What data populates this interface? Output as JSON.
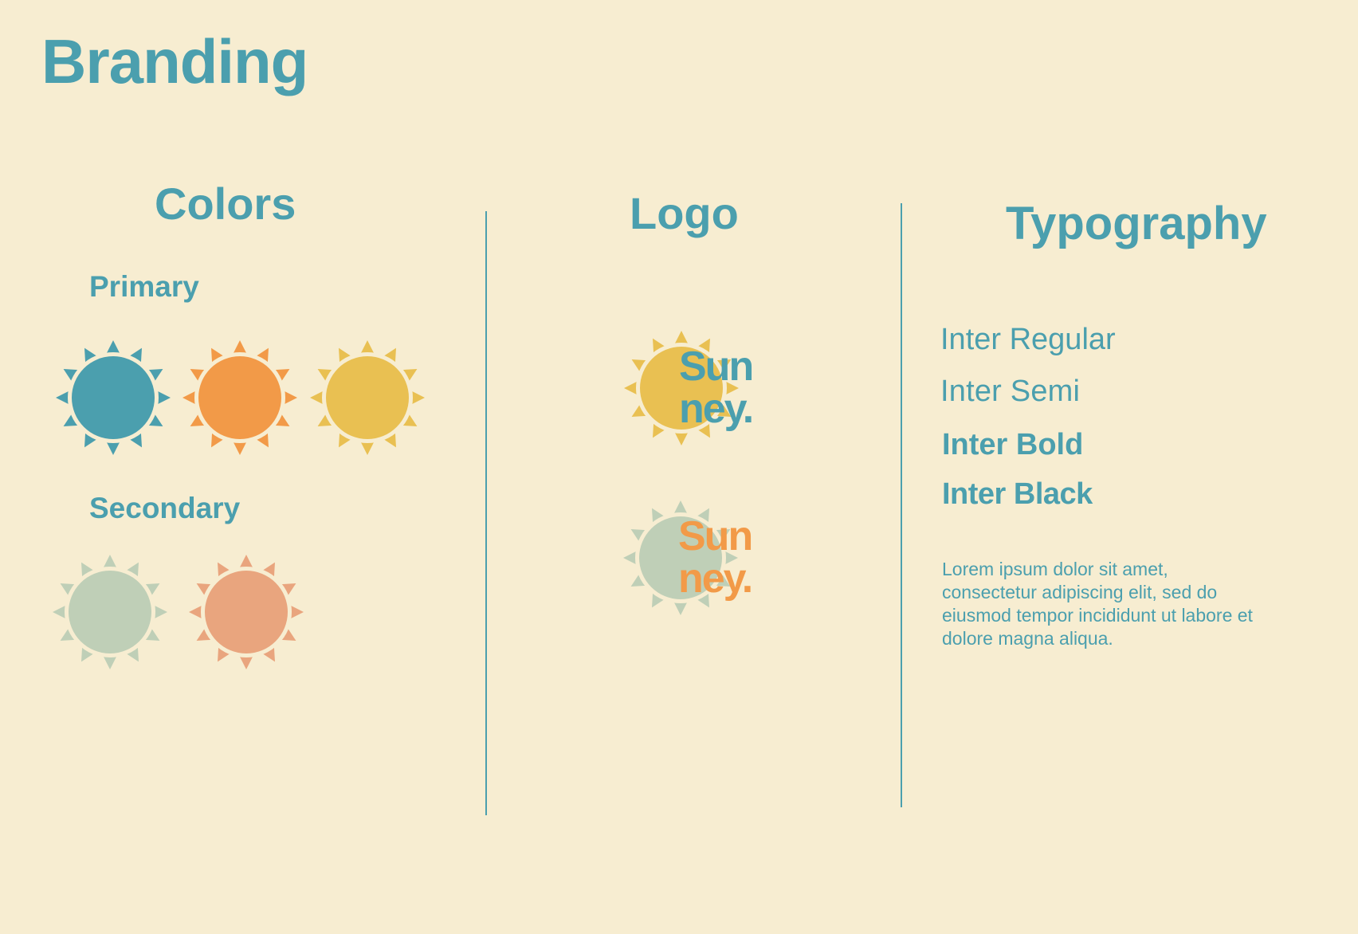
{
  "title": "Branding",
  "colors": {
    "heading": "Colors",
    "primary_label": "Primary",
    "secondary_label": "Secondary",
    "primary": [
      "#4b9fae",
      "#f29a48",
      "#e9c052"
    ],
    "secondary": [
      "#bfcfb7",
      "#e9a57e"
    ]
  },
  "logo": {
    "heading": "Logo",
    "word_line1": "Sun",
    "word_line2": "ney.",
    "variants": [
      {
        "sun_color": "#e9c052",
        "text_color": "#4b9fae"
      },
      {
        "sun_color": "#bfcfb7",
        "text_color": "#f29a48"
      }
    ]
  },
  "typography": {
    "heading": "Typography",
    "samples": {
      "regular": "Inter Regular",
      "semi": "Inter Semi",
      "bold": "Inter Bold",
      "black": "Inter Black"
    },
    "body_sample": "Lorem ipsum dolor sit amet, consectetur adipiscing elit, sed do eiusmod tempor incididunt ut labore et dolore magna aliqua."
  },
  "theme": {
    "background": "#f7edd1",
    "accent": "#4b9fae",
    "sun_ring": "#f7edd1"
  }
}
